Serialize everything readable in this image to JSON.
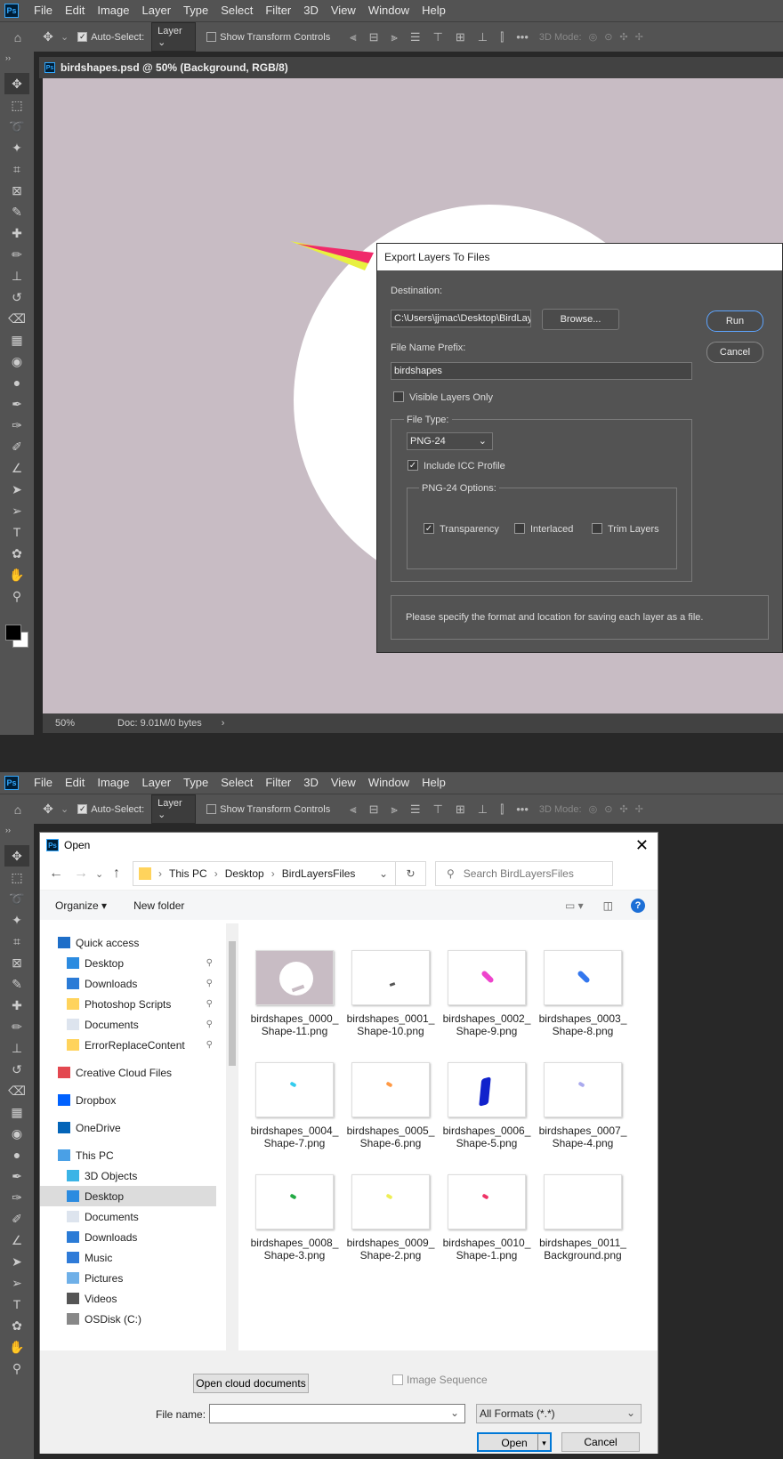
{
  "app": {
    "logo": "Ps",
    "menu": [
      "File",
      "Edit",
      "Image",
      "Layer",
      "Type",
      "Select",
      "Filter",
      "3D",
      "View",
      "Window",
      "Help"
    ]
  },
  "options": {
    "auto_select_label": "Auto-Select:",
    "layer_dropdown": "Layer",
    "show_transform_label": "Show Transform Controls",
    "mode_3d_label": "3D Mode:"
  },
  "document": {
    "tab_title": "birdshapes.psd @ 50% (Background, RGB/8)",
    "zoom": "50%",
    "doc_info": "Doc: 9.01M/0 bytes"
  },
  "export_dialog": {
    "title": "Export Layers To Files",
    "destination_label": "Destination:",
    "destination_value": "C:\\Users\\jjmac\\Desktop\\BirdLaye",
    "browse_label": "Browse...",
    "run_label": "Run",
    "cancel_label": "Cancel",
    "prefix_label": "File Name Prefix:",
    "prefix_value": "birdshapes",
    "visible_only_label": "Visible Layers Only",
    "file_type_label": "File Type:",
    "file_type_value": "PNG-24",
    "icc_label": "Include ICC Profile",
    "options_label": "PNG-24 Options:",
    "transparency_label": "Transparency",
    "interlaced_label": "Interlaced",
    "trim_label": "Trim Layers",
    "hint": "Please specify the format and location for saving each layer as a file."
  },
  "open_dialog": {
    "title": "Open",
    "breadcrumb": [
      "This PC",
      "Desktop",
      "BirdLayersFiles"
    ],
    "search_placeholder": "Search BirdLayersFiles",
    "organize_label": "Organize",
    "new_folder_label": "New folder",
    "nav": [
      {
        "label": "Quick access",
        "icon": "star-icon",
        "level": 0
      },
      {
        "label": "Desktop",
        "icon": "desktop-icon",
        "level": 1,
        "pinned": true
      },
      {
        "label": "Downloads",
        "icon": "download-icon",
        "level": 1,
        "pinned": true
      },
      {
        "label": "Photoshop Scripts",
        "icon": "folder-icon",
        "level": 1,
        "pinned": true
      },
      {
        "label": "Documents",
        "icon": "document-icon",
        "level": 1,
        "pinned": true
      },
      {
        "label": "ErrorReplaceContent",
        "icon": "folder-icon",
        "level": 1,
        "pinned": true
      },
      {
        "label": "Creative Cloud Files",
        "icon": "creative-cloud-icon",
        "level": 0
      },
      {
        "label": "Dropbox",
        "icon": "dropbox-icon",
        "level": 0
      },
      {
        "label": "OneDrive",
        "icon": "onedrive-icon",
        "level": 0
      },
      {
        "label": "This PC",
        "icon": "computer-icon",
        "level": 0
      },
      {
        "label": "3D Objects",
        "icon": "cube-icon",
        "level": 1
      },
      {
        "label": "Desktop",
        "icon": "desktop-icon",
        "level": 1,
        "selected": true
      },
      {
        "label": "Documents",
        "icon": "document-icon",
        "level": 1
      },
      {
        "label": "Downloads",
        "icon": "download-icon",
        "level": 1
      },
      {
        "label": "Music",
        "icon": "music-icon",
        "level": 1
      },
      {
        "label": "Pictures",
        "icon": "picture-icon",
        "level": 1
      },
      {
        "label": "Videos",
        "icon": "video-icon",
        "level": 1
      },
      {
        "label": "OSDisk (C:)",
        "icon": "disk-icon",
        "level": 1
      }
    ],
    "files": [
      {
        "line1": "birdshapes_0000_",
        "line2": "Shape-11.png",
        "thumb": "background",
        "color": "#c8bcc4"
      },
      {
        "line1": "birdshapes_0001_",
        "line2": "Shape-10.png",
        "thumb": "tiny-bird",
        "color": "#555555"
      },
      {
        "line1": "birdshapes_0002_",
        "line2": "Shape-9.png",
        "thumb": "stroke",
        "color": "#ee44cc"
      },
      {
        "line1": "birdshapes_0003_",
        "line2": "Shape-8.png",
        "thumb": "stroke",
        "color": "#3377ee"
      },
      {
        "line1": "birdshapes_0004_",
        "line2": "Shape-7.png",
        "thumb": "dot",
        "color": "#33ccee"
      },
      {
        "line1": "birdshapes_0005_",
        "line2": "Shape-6.png",
        "thumb": "dot",
        "color": "#ff9944"
      },
      {
        "line1": "birdshapes_0006_",
        "line2": "Shape-5.png",
        "thumb": "bolt",
        "color": "#1122cc"
      },
      {
        "line1": "birdshapes_0007_",
        "line2": "Shape-4.png",
        "thumb": "dot",
        "color": "#aaaaee"
      },
      {
        "line1": "birdshapes_0008_",
        "line2": "Shape-3.png",
        "thumb": "dot",
        "color": "#22aa44"
      },
      {
        "line1": "birdshapes_0009_",
        "line2": "Shape-2.png",
        "thumb": "dot",
        "color": "#eeee55"
      },
      {
        "line1": "birdshapes_0010_",
        "line2": "Shape-1.png",
        "thumb": "dot",
        "color": "#ee3366"
      },
      {
        "line1": "birdshapes_0011_",
        "line2": "Background.png",
        "thumb": "blank",
        "color": "#ffffff"
      }
    ],
    "cloud_docs_label": "Open cloud documents",
    "image_sequence_label": "Image Sequence",
    "file_name_label": "File name:",
    "file_name_value": "",
    "format_value": "All Formats (*.*)",
    "open_label": "Open",
    "cancel_label": "Cancel"
  }
}
